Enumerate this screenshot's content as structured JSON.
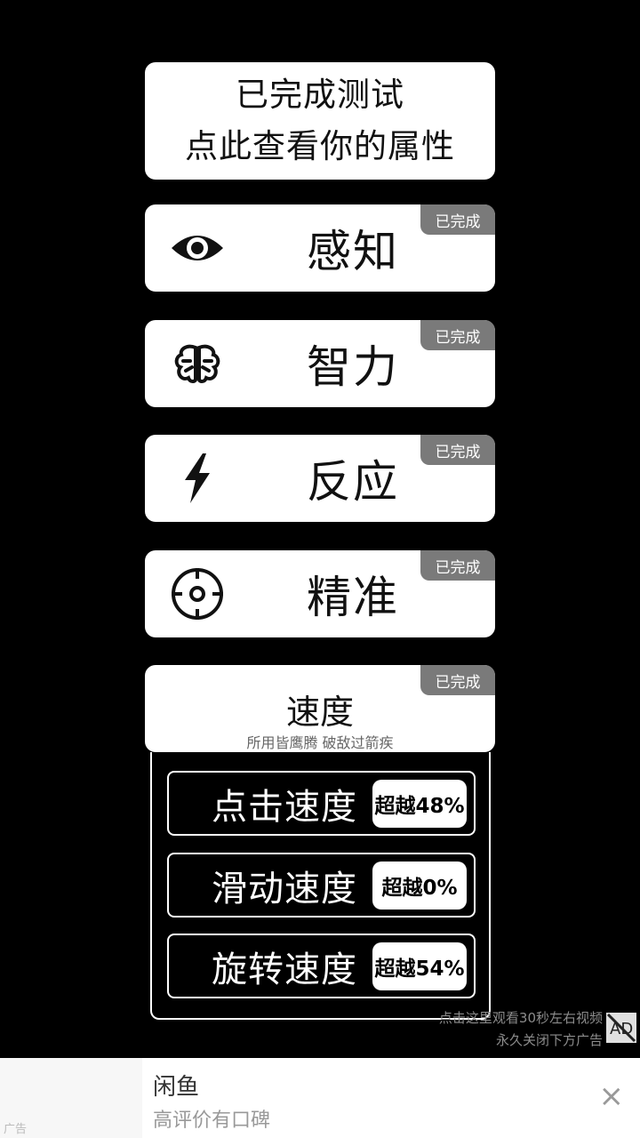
{
  "summary": {
    "line1": "已完成测试",
    "line2": "点此查看你的属性"
  },
  "tests": [
    {
      "label": "感知",
      "badge": "已完成",
      "icon": "eye-icon"
    },
    {
      "label": "智力",
      "badge": "已完成",
      "icon": "brain-icon"
    },
    {
      "label": "反应",
      "badge": "已完成",
      "icon": "lightning-icon"
    },
    {
      "label": "精准",
      "badge": "已完成",
      "icon": "crosshair-icon"
    }
  ],
  "speed": {
    "title": "速度",
    "subtitle": "所用皆鹰腾 破敌过箭疾",
    "badge": "已完成",
    "metrics": [
      {
        "label": "点击速度",
        "result": "超越48%"
      },
      {
        "label": "滑动速度",
        "result": "超越0%"
      },
      {
        "label": "旋转速度",
        "result": "超越54%"
      }
    ]
  },
  "ad_hint": {
    "line1": "点击这里观看30秒左右视频",
    "line2": "永久关闭下方广告"
  },
  "ad_banner": {
    "tag": "广告",
    "title": "闲鱼",
    "description": "高评价有口碑",
    "close": "×"
  }
}
